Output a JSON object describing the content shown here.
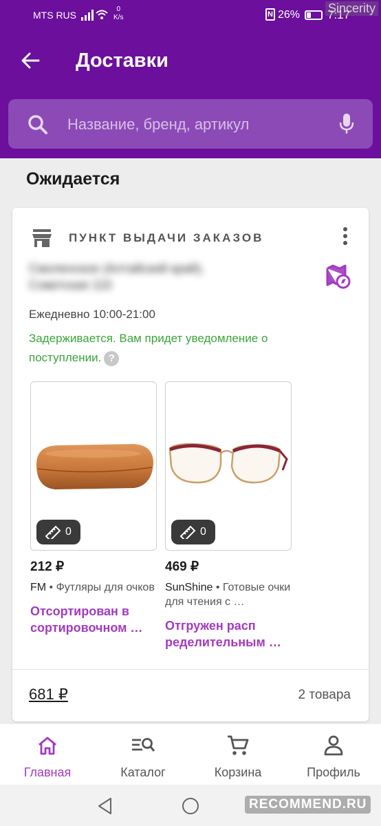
{
  "status_bar": {
    "carrier": "MTS RUS",
    "speed_value": "0",
    "speed_unit": "K/s",
    "battery": "26%",
    "time": "7:17"
  },
  "watermark_top": "Sincerity",
  "header": {
    "title": "Доставки",
    "search_placeholder": "Название, бренд, артикул"
  },
  "section_title": "Ожидается",
  "delivery": {
    "point_label": "ПУНКТ ВЫДАЧИ ЗАКАЗОВ",
    "address": "Смоленское (Алтайский край), Советская 110",
    "hours": "Ежедневно 10:00-21:00",
    "notice": "Задерживается. Вам придет уведомление о поступлении.",
    "help_symbol": "?",
    "products": [
      {
        "price": "212 ₽",
        "brand": "FM",
        "category": " • Футляры для очков",
        "status": "Отсортирован в сортировочном …",
        "fitting_count": "0"
      },
      {
        "price": "469 ₽",
        "brand": "SunShine",
        "category": " • Готовые очки для чтения с …",
        "status": "Отгружен расп ределительным …",
        "fitting_count": "0"
      }
    ],
    "total": "681 ₽",
    "items_count": "2 товара"
  },
  "bottom_nav": [
    {
      "label": "Главная",
      "icon": "home-icon",
      "active": true
    },
    {
      "label": "Каталог",
      "icon": "catalog-search-icon",
      "active": false
    },
    {
      "label": "Корзина",
      "icon": "cart-icon",
      "active": false
    },
    {
      "label": "Профиль",
      "icon": "profile-icon",
      "active": false
    }
  ],
  "watermark_bottom": "RECOMMEND.RU",
  "colors": {
    "brand_purple": "#6b0f9c",
    "accent_violet": "#a33ac0",
    "notice_green": "#3aa53a"
  }
}
